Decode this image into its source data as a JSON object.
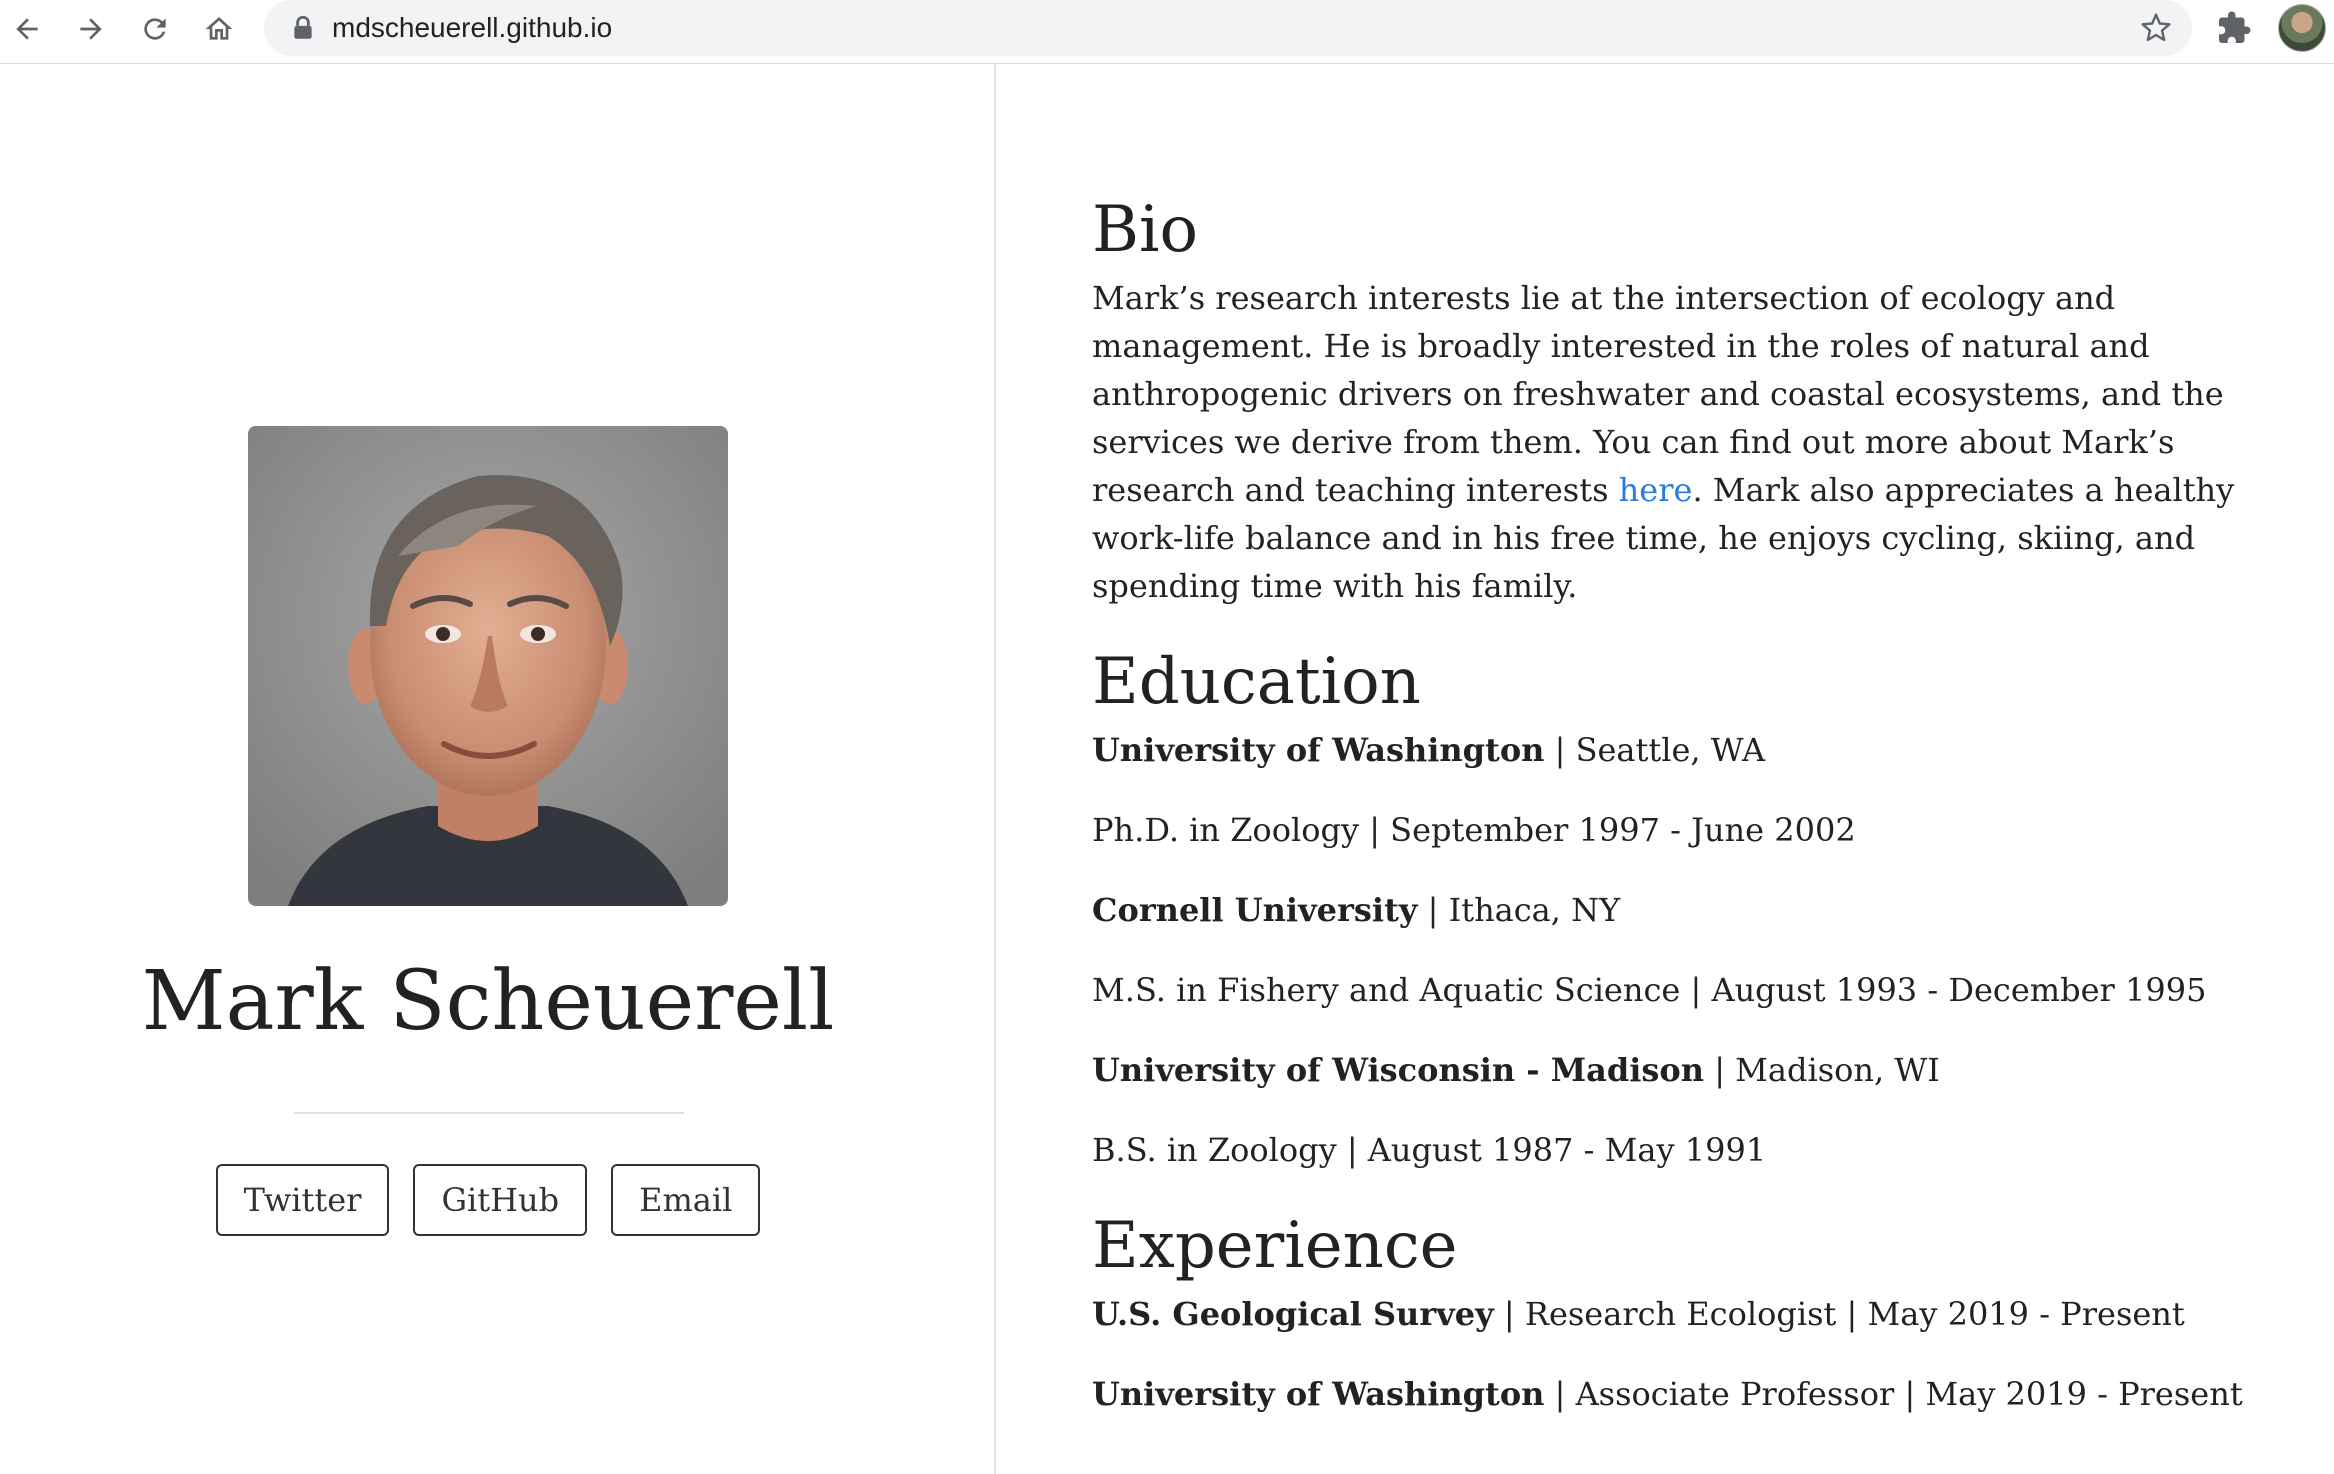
{
  "browser": {
    "url": "mdscheuerell.github.io"
  },
  "profile": {
    "name": "Mark Scheuerell",
    "buttons": [
      "Twitter",
      "GitHub",
      "Email"
    ]
  },
  "bio": {
    "title": "Bio",
    "text_before_link": "Mark’s research interests lie at the intersection of ecology and management. He is broadly interested in the roles of natural and anthropogenic drivers on freshwater and coastal ecosystems, and the services we derive from them. You can find out more about Mark’s research and teaching interests ",
    "link_text": "here",
    "text_after_link": ". Mark also appreciates a healthy work-life balance and in his free time, he enjoys cycling, skiing, and spending time with his family."
  },
  "education": {
    "title": "Education",
    "entries": [
      {
        "strong": "University of Washington",
        "rest": " | Seattle, WA"
      },
      {
        "strong": "",
        "rest": "Ph.D. in Zoology | September 1997 - June 2002"
      },
      {
        "strong": "Cornell University",
        "rest": " | Ithaca, NY"
      },
      {
        "strong": "",
        "rest": "M.S. in Fishery and Aquatic Science | August 1993 - December 1995"
      },
      {
        "strong": "University of Wisconsin - Madison",
        "rest": " | Madison, WI"
      },
      {
        "strong": "",
        "rest": "B.S. in Zoology | August 1987 - May 1991"
      }
    ]
  },
  "experience": {
    "title": "Experience",
    "entries": [
      {
        "strong": "U.S. Geological Survey",
        "rest": " | Research Ecologist | May 2019 - Present"
      },
      {
        "strong": "University of Washington",
        "rest": " | Associate Professor | May 2019 - Present"
      }
    ]
  },
  "icons": {
    "back": "arrow-left-icon",
    "forward": "arrow-right-icon",
    "reload": "reload-icon",
    "home": "home-icon",
    "lock": "lock-icon",
    "bookmark": "star-icon",
    "extensions": "puzzle-icon"
  },
  "colors": {
    "link": "#2a7ae2",
    "text": "#222222",
    "omnibox": "#f1f3f4"
  }
}
